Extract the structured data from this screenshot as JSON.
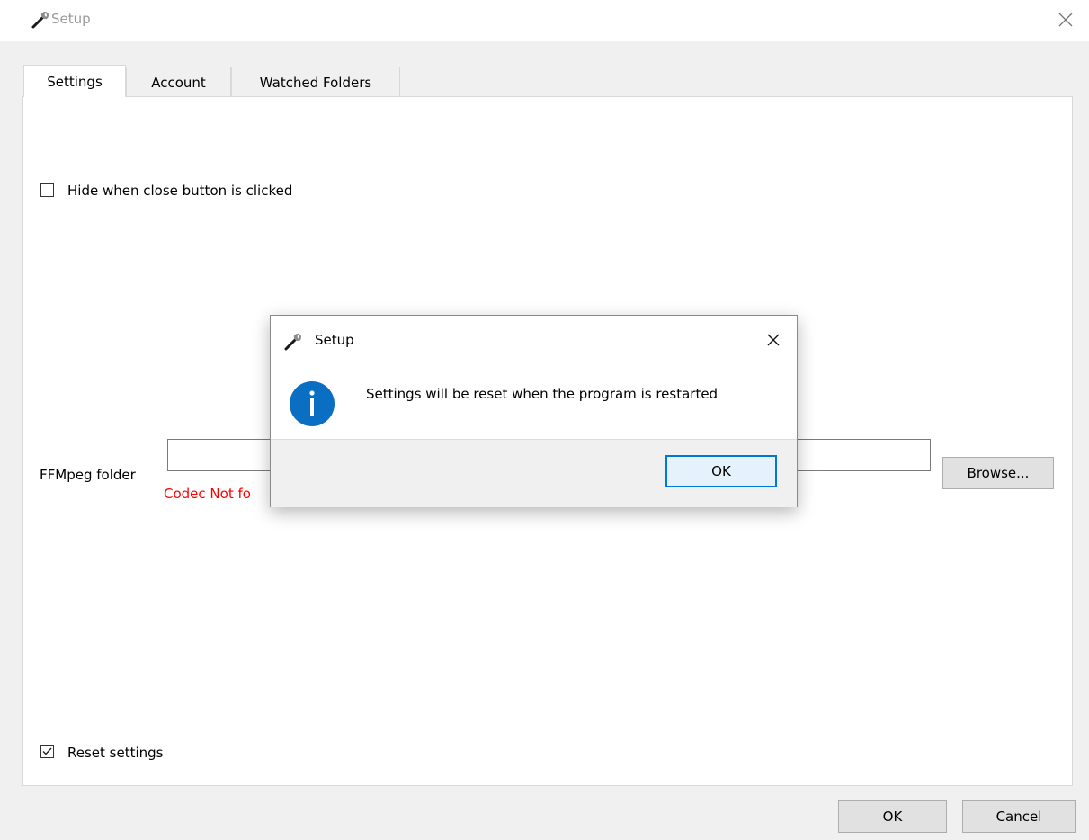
{
  "window": {
    "title": "Setup",
    "icon": "wrench-icon",
    "close_glyph": "×"
  },
  "tabs": [
    {
      "label": "Settings",
      "active": true
    },
    {
      "label": "Account",
      "active": false
    },
    {
      "label": "Watched Folders",
      "active": false
    }
  ],
  "settings": {
    "hide_on_close": {
      "label": "Hide when close button is clicked",
      "checked": false
    },
    "ffmpeg": {
      "label": "FFMpeg folder",
      "value": "",
      "error": "Codec Not fo",
      "browse_label": "Browse..."
    },
    "reset": {
      "label": "Reset settings",
      "checked": true
    }
  },
  "footer": {
    "ok_label": "OK",
    "cancel_label": "Cancel"
  },
  "dialog": {
    "title": "Setup",
    "message": "Settings will be reset when the program is restarted",
    "ok_label": "OK",
    "icon": "info-icon",
    "icon_color": "#0a6fc2"
  }
}
